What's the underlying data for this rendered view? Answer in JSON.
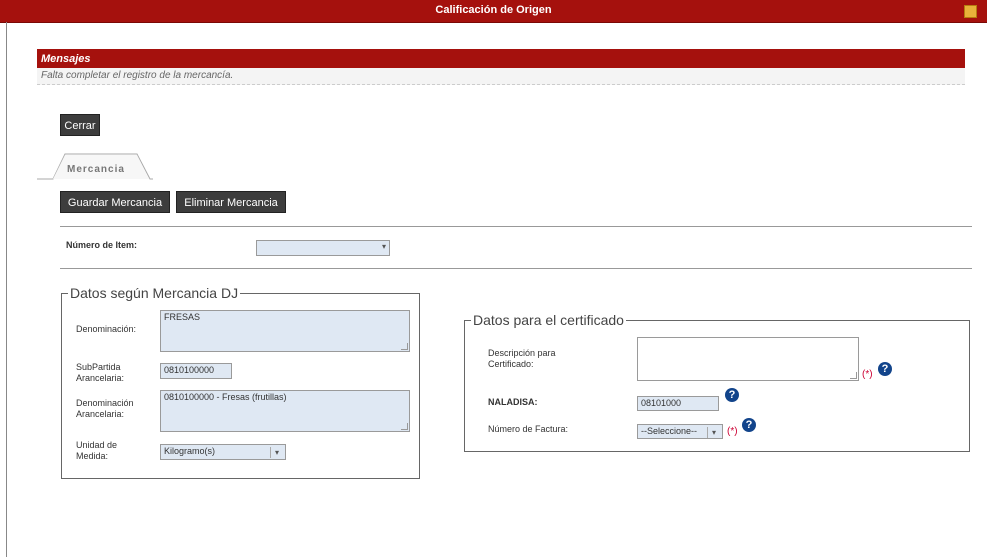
{
  "window": {
    "title": "Calificación de Origen"
  },
  "messages": {
    "header": "Mensajes",
    "text": "Falta completar el registro de la mercancía."
  },
  "buttons": {
    "close": "Cerrar",
    "save": "Guardar Mercancia",
    "delete": "Eliminar Mercancia"
  },
  "tab": {
    "label": "Mercancia"
  },
  "item": {
    "label": "Número de Item:",
    "value": ""
  },
  "dj": {
    "legend": "Datos según Mercancia DJ",
    "denominacion_label": "Denominación:",
    "denominacion_value": "FRESAS",
    "subpartida_label": "SubPartida Arancelaria:",
    "subpartida_value": "0810100000",
    "den_arancelaria_label": "Denominación Arancelaria:",
    "den_arancelaria_value": "0810100000 - Fresas (frutillas)",
    "unidad_label": "Unidad de Medida:",
    "unidad_value": "Kilogramo(s)"
  },
  "cert": {
    "legend": "Datos para el certificado",
    "descripcion_label": "Descripción para Certificado:",
    "descripcion_value": "",
    "naladisa_label": "NALADISA:",
    "naladisa_value": "08101000",
    "factura_label": "Número de Factura:",
    "factura_value": "--Seleccione--",
    "required_mark": "(*)",
    "help_glyph": "?"
  },
  "colors": {
    "brand_red": "#a5110d",
    "button_dark": "#3d3d3d",
    "input_bg": "#dfe8f3",
    "help_blue": "#12448b"
  }
}
